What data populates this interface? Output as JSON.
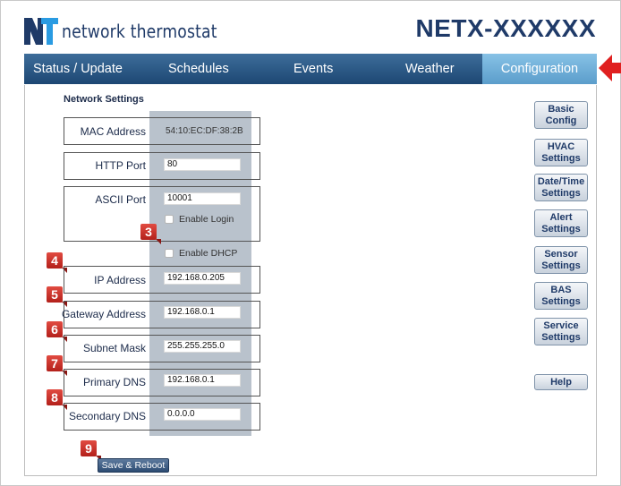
{
  "header": {
    "brand_name": "network thermostat",
    "device_name": "NETX-XXXXXX"
  },
  "nav": {
    "tabs": [
      {
        "label": "Status / Update"
      },
      {
        "label": "Schedules"
      },
      {
        "label": "Events"
      },
      {
        "label": "Weather"
      },
      {
        "label": "Configuration",
        "active": true
      }
    ]
  },
  "section": {
    "title": "Network Settings"
  },
  "fields": {
    "mac": {
      "label": "MAC Address",
      "value": "54:10:EC:DF:38:2B"
    },
    "http_port": {
      "label": "HTTP Port",
      "value": "80"
    },
    "ascii_port": {
      "label": "ASCII Port",
      "value": "10001"
    },
    "enable_login": {
      "label": "Enable Login",
      "checked": false
    },
    "enable_dhcp": {
      "label": "Enable DHCP",
      "checked": false
    },
    "ip_address": {
      "label": "IP Address",
      "value": "192.168.0.205"
    },
    "gateway": {
      "label": "Gateway Address",
      "value": "192.168.0.1"
    },
    "subnet": {
      "label": "Subnet Mask",
      "value": "255.255.255.0"
    },
    "primary_dns": {
      "label": "Primary DNS",
      "value": "192.168.0.1"
    },
    "secondary_dns": {
      "label": "Secondary DNS",
      "value": "0.0.0.0"
    }
  },
  "badges": {
    "dhcp": "3",
    "ip": "4",
    "gateway": "5",
    "subnet": "6",
    "primary_dns": "7",
    "secondary_dns": "8",
    "save": "9"
  },
  "side_buttons": {
    "basic_config": "Basic Config",
    "hvac_settings": "HVAC Settings",
    "date_time_settings": "Date/Time Settings",
    "alert_settings": "Alert Settings",
    "sensor_settings": "Sensor Settings",
    "bas_settings": "BAS Settings",
    "service_settings": "Service Settings",
    "help": "Help"
  },
  "save_button": "Save & Reboot",
  "colors": {
    "nav_bar": "#2c5a87",
    "active_tab": "#6fb0da",
    "brand": "#1f3a68",
    "badge_red": "#c8302a",
    "value_column": "#b9c2cc",
    "arrow": "#e02020"
  },
  "icons": {
    "logo": "nt-logo-icon",
    "pointer": "red-arrow-pointer-icon"
  }
}
